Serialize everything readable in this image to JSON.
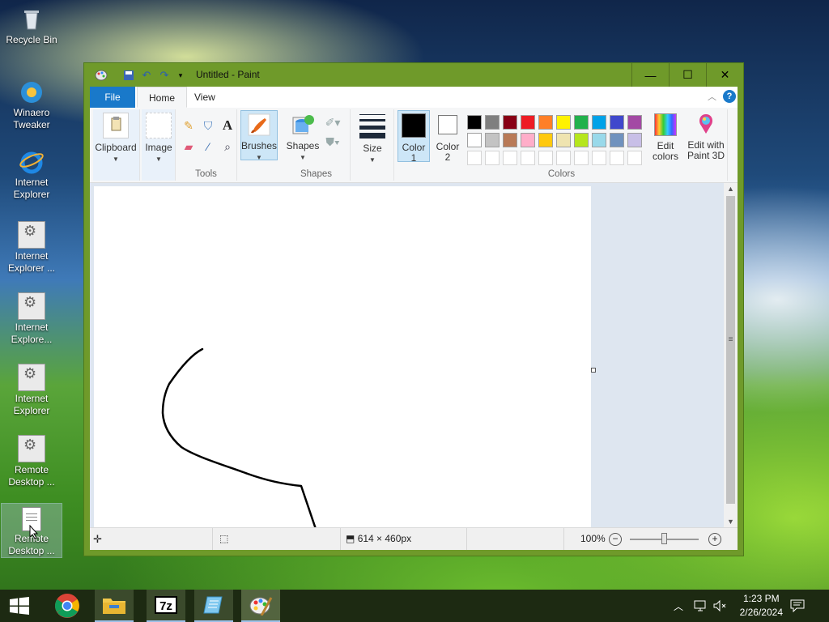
{
  "desktop": {
    "icons": [
      {
        "label": "Recycle Bin"
      },
      {
        "label": "Winaero Tweaker"
      },
      {
        "label": "Internet Explorer"
      },
      {
        "label": "Internet Explorer ..."
      },
      {
        "label": "Internet Explore..."
      },
      {
        "label": "Internet Explorer"
      },
      {
        "label": "Remote Desktop ..."
      },
      {
        "label": "Remote Desktop ..."
      }
    ]
  },
  "window": {
    "title": "Untitled - Paint",
    "minimize": "—",
    "maximize": "☐",
    "close": "✕"
  },
  "tabs": {
    "file": "File",
    "home": "Home",
    "view": "View"
  },
  "ribbon": {
    "clipboard": "Clipboard",
    "image": "Image",
    "tools_group": "Tools",
    "brushes": "Brushes",
    "shapes": "Shapes",
    "shapes_group": "Shapes",
    "size": "Size",
    "color1_line1": "Color",
    "color1_line2": "1",
    "color2_line1": "Color",
    "color2_line2": "2",
    "colors_group": "Colors",
    "edit_colors_line1": "Edit",
    "edit_colors_line2": "colors",
    "edit3d_line1": "Edit with",
    "edit3d_line2": "Paint 3D"
  },
  "palette": {
    "row1": [
      "#000000",
      "#7f7f7f",
      "#880015",
      "#ed1c24",
      "#ff7f27",
      "#fff200",
      "#22b14c",
      "#00a2e8",
      "#3f48cc",
      "#a349a4"
    ],
    "row2": [
      "#ffffff",
      "#c3c3c3",
      "#b97a57",
      "#ffaec9",
      "#ffc90e",
      "#efe4b0",
      "#b5e61d",
      "#99d9ea",
      "#7092be",
      "#c8bfe7"
    ],
    "color1": "#000000",
    "color2": "#ffffff"
  },
  "status": {
    "size": "614 × 460px",
    "zoom": "100%",
    "zoom_level_percent": 100
  },
  "taskbar": {
    "time": "1:23 PM",
    "date": "2/26/2024"
  }
}
